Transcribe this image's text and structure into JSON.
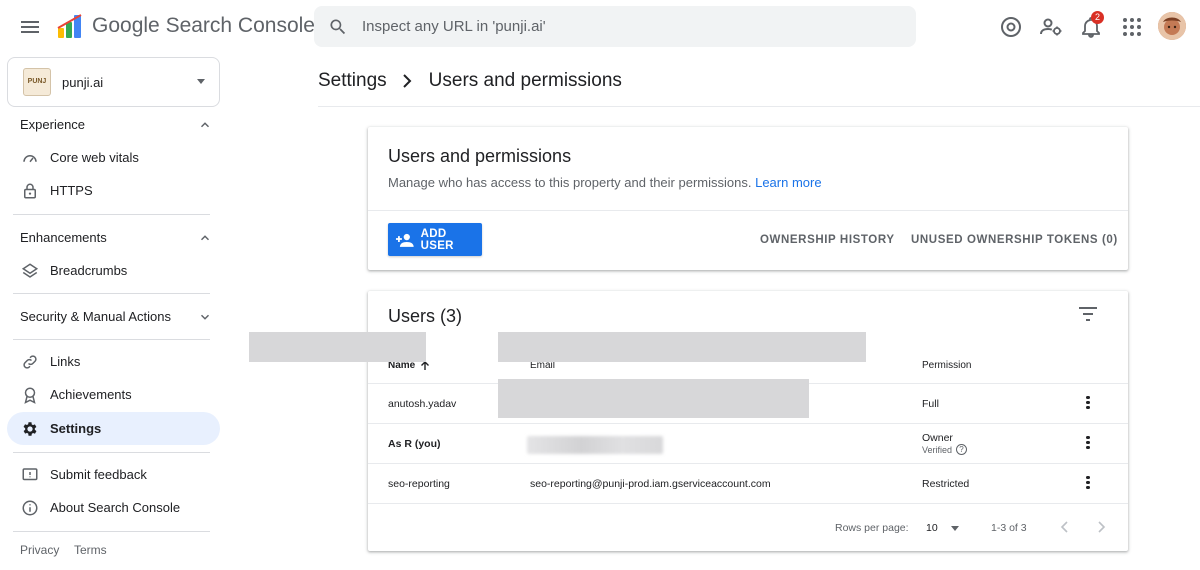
{
  "app": {
    "title": "Google Search Console",
    "title_google": "Google",
    "title_rest": "Search Console",
    "notification_count": "2"
  },
  "search": {
    "placeholder": "Inspect any URL in 'punji.ai'"
  },
  "property": {
    "name": "punji.ai",
    "logo_text": "PUNJ"
  },
  "sidebar": {
    "sections": [
      {
        "label": "Experience",
        "expanded": true
      },
      {
        "label": "Enhancements",
        "expanded": true
      },
      {
        "label": "Security & Manual Actions",
        "expanded": false
      }
    ],
    "items": [
      {
        "label": "Core web vitals",
        "icon": "speedometer-icon"
      },
      {
        "label": "HTTPS",
        "icon": "lock-icon"
      },
      {
        "label": "Breadcrumbs",
        "icon": "layers-icon"
      },
      {
        "label": "Links",
        "icon": "link-icon"
      },
      {
        "label": "Achievements",
        "icon": "award-icon"
      },
      {
        "label": "Settings",
        "icon": "gear-icon",
        "active": true
      },
      {
        "label": "Submit feedback",
        "icon": "feedback-icon"
      },
      {
        "label": "About Search Console",
        "icon": "info-icon"
      }
    ],
    "footer": {
      "privacy": "Privacy",
      "terms": "Terms"
    }
  },
  "breadcrumb": {
    "parent": "Settings",
    "current": "Users and permissions"
  },
  "permissions_card": {
    "title": "Users and permissions",
    "description": "Manage who has access to this property and their permissions.",
    "learn_more": "Learn more",
    "add_user": "ADD USER",
    "ownership_history": "OWNERSHIP HISTORY",
    "unused_tokens": "UNUSED OWNERSHIP TOKENS (0)"
  },
  "users_card": {
    "title": "Users (3)",
    "columns": {
      "name": "Name",
      "email": "Email",
      "permission": "Permission"
    },
    "rows": [
      {
        "name": "anutosh.yadav",
        "email": "",
        "permission": "Full"
      },
      {
        "name": "As R (you)",
        "email": "",
        "permission": "Owner",
        "verified": "Verified"
      },
      {
        "name": "seo-reporting",
        "email": "seo-reporting@punji-prod.iam.gserviceaccount.com",
        "permission": "Restricted"
      }
    ],
    "pagination": {
      "rows_per_page_label": "Rows per page:",
      "rows_per_page": "10",
      "range": "1-3 of 3"
    }
  },
  "colors": {
    "accent": "#1a73e8",
    "active_nav_bg": "#e8f0fe",
    "badge": "#d93025"
  }
}
